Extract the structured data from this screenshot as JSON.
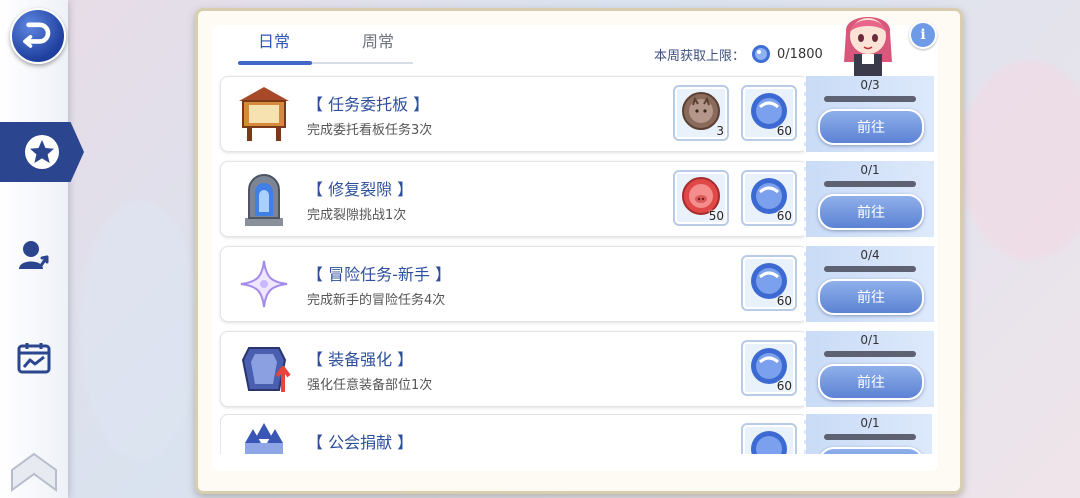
{
  "tabs": [
    {
      "label": "日常",
      "active": true
    },
    {
      "label": "周常",
      "active": false
    }
  ],
  "weekly_limit": {
    "label": "本周获取上限：",
    "value": "0/1800"
  },
  "sidebar": {
    "items": [
      {
        "icon": "back-icon"
      },
      {
        "icon": "star-icon",
        "active": true
      },
      {
        "icon": "user-upgrade-icon"
      },
      {
        "icon": "calendar-chart-icon"
      },
      {
        "icon": "chevron-up-icon"
      }
    ]
  },
  "tasks": [
    {
      "title": "【 任务委托板 】",
      "desc": "完成委托看板任务3次",
      "rewards": [
        {
          "icon": "cat-coin-icon",
          "num": "3"
        },
        {
          "icon": "blue-gem-icon",
          "num": "60"
        }
      ],
      "progress": "0/3",
      "progress_fraction": 0,
      "button": "前往"
    },
    {
      "title": "【 修复裂隙 】",
      "desc": "完成裂隙挑战1次",
      "rewards": [
        {
          "icon": "pig-coin-icon",
          "num": "50"
        },
        {
          "icon": "blue-gem-icon",
          "num": "60"
        }
      ],
      "progress": "0/1",
      "progress_fraction": 0,
      "button": "前往"
    },
    {
      "title": "【 冒险任务-新手 】",
      "desc": "完成新手的冒险任务4次",
      "rewards": [
        {
          "icon": "blue-gem-icon",
          "num": "60"
        }
      ],
      "progress": "0/4",
      "progress_fraction": 0,
      "button": "前往"
    },
    {
      "title": "【 装备强化 】",
      "desc": "强化任意装备部位1次",
      "rewards": [
        {
          "icon": "blue-gem-icon",
          "num": "60"
        }
      ],
      "progress": "0/1",
      "progress_fraction": 0,
      "button": "前往"
    },
    {
      "title": "【 公会捐献 】",
      "desc": "",
      "rewards": [
        {
          "icon": "blue-gem-icon",
          "num": ""
        }
      ],
      "progress": "0/1",
      "progress_fraction": 0,
      "button": ""
    }
  ],
  "colors": {
    "accent": "#2f57b8",
    "sidebar_active": "#2b458f",
    "button": "#5c82d4",
    "progress_bg": "#5d6172"
  }
}
